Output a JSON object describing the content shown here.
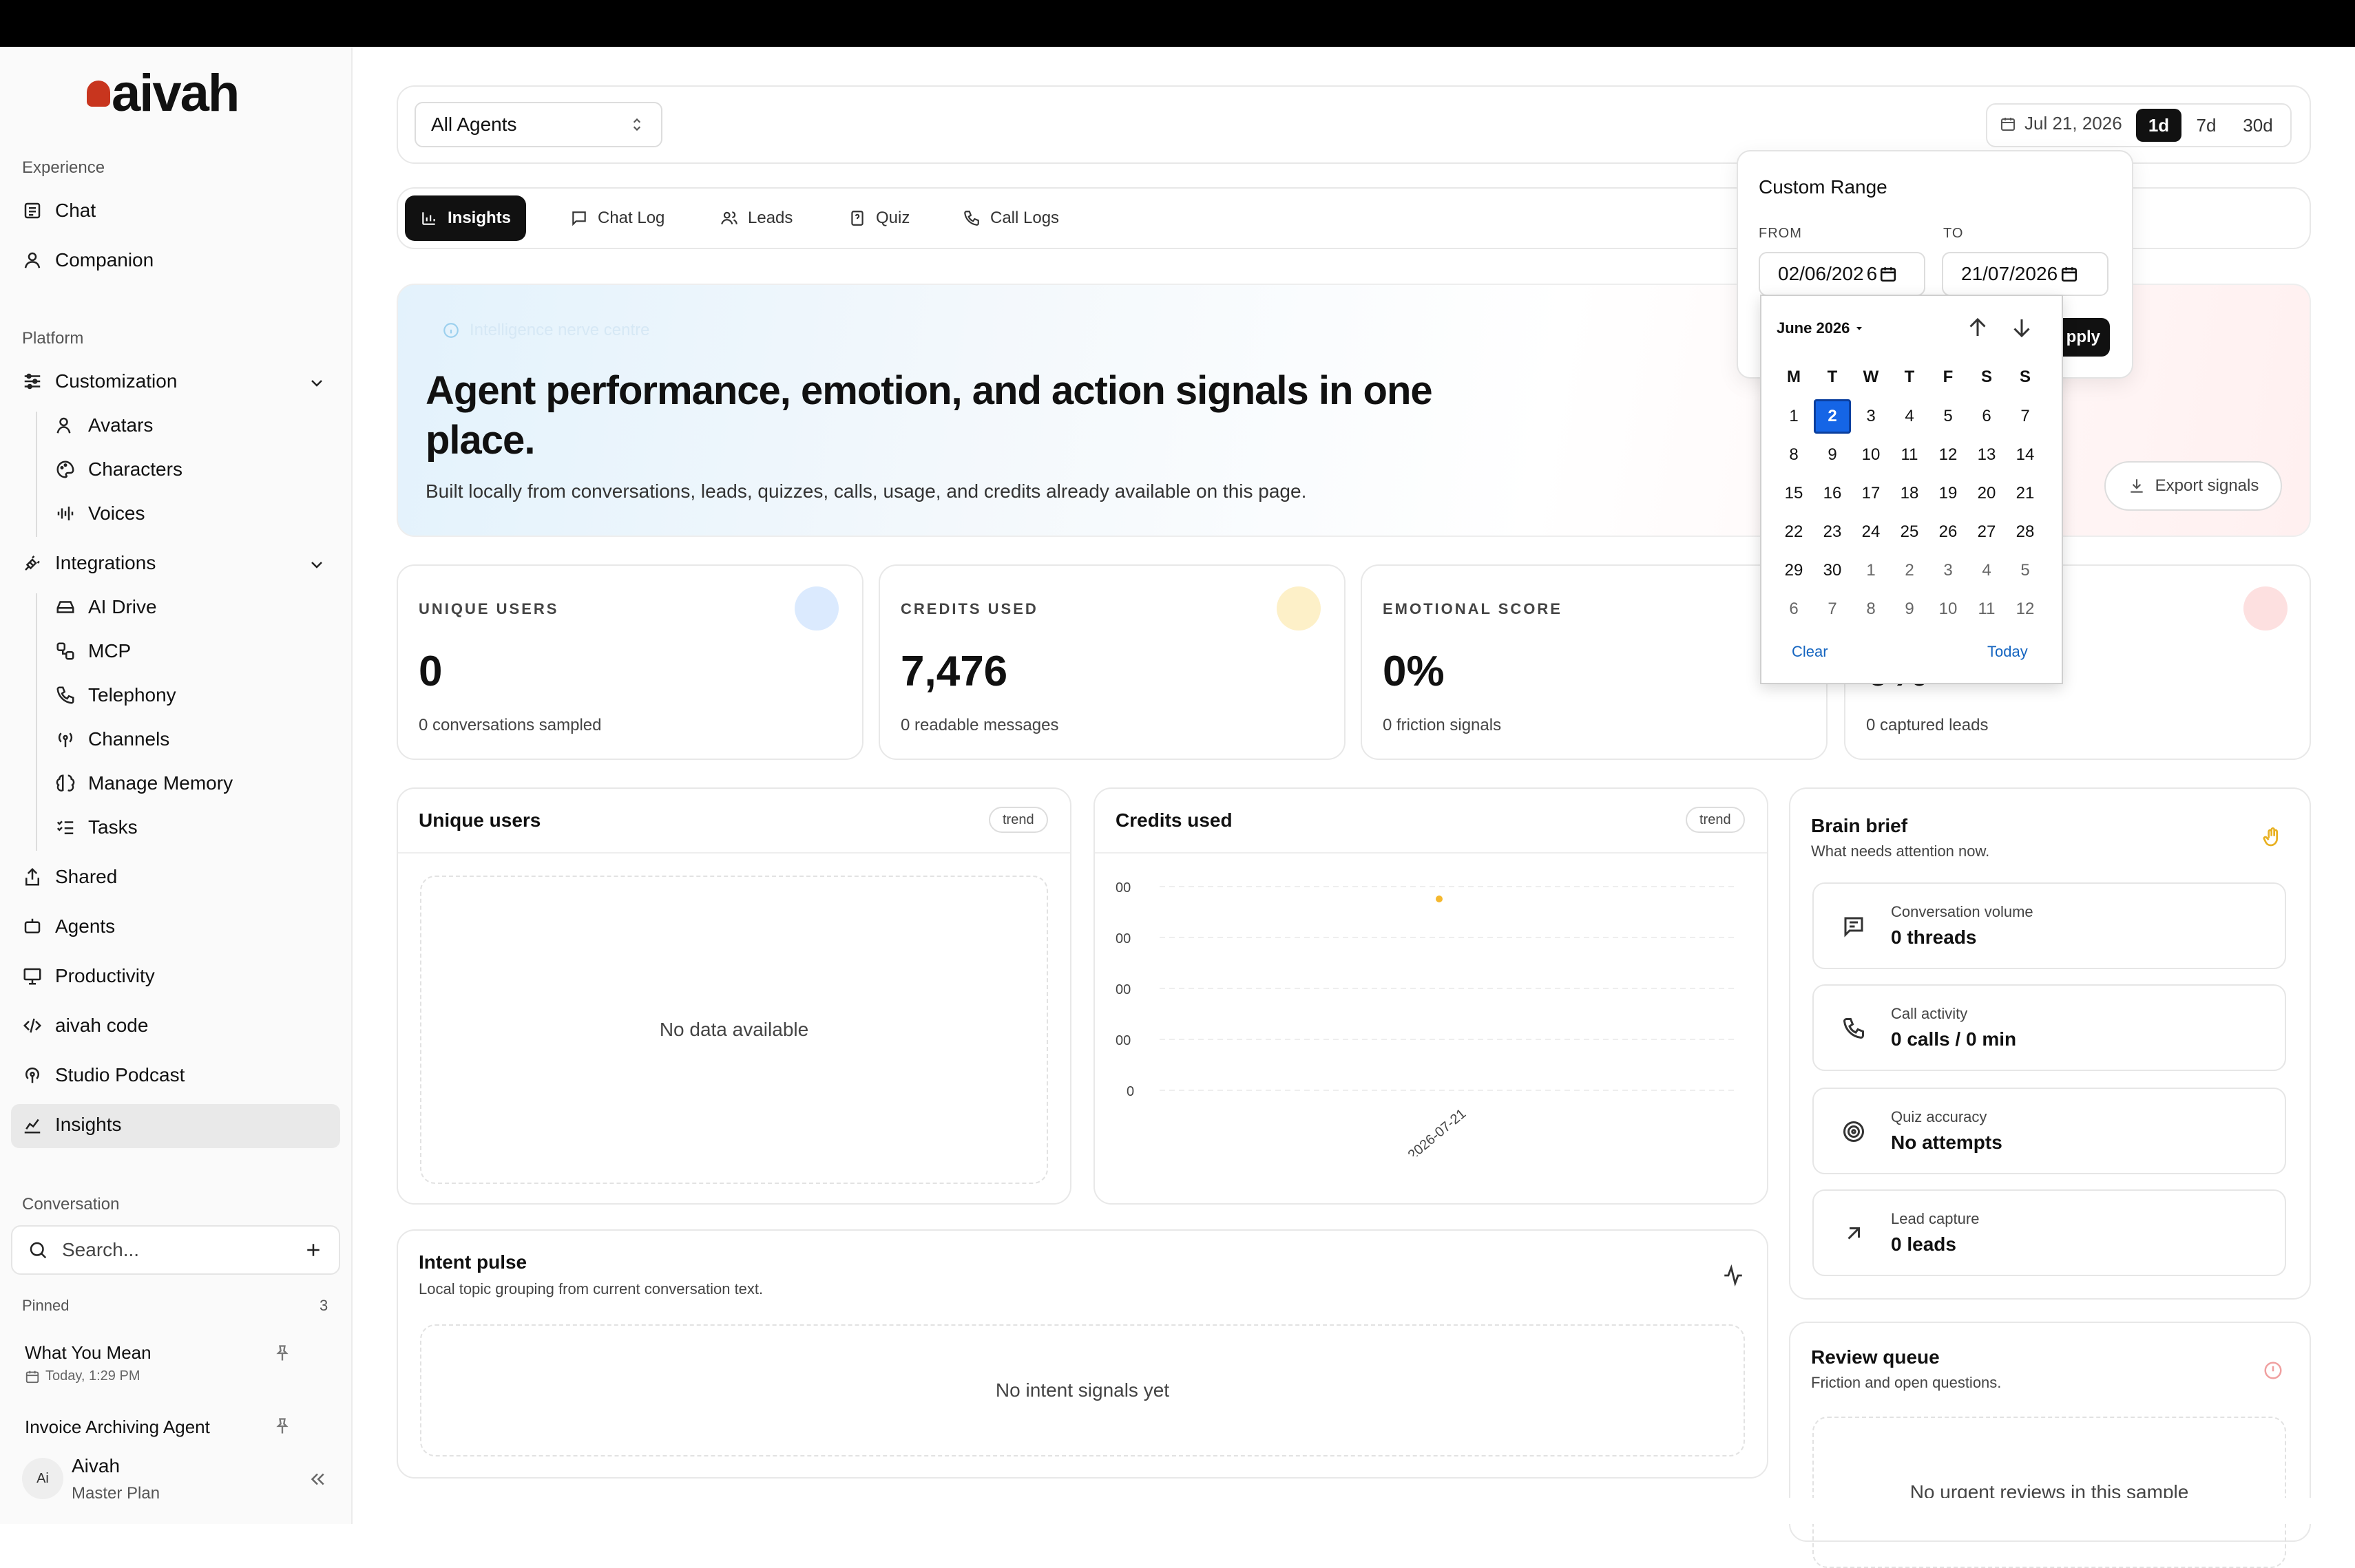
{
  "brand": {
    "name": "aivah",
    "accent": "#c8351e"
  },
  "sidebar": {
    "section_experience": "Experience",
    "chat": "Chat",
    "companion": "Companion",
    "section_platform": "Platform",
    "customization": "Customization",
    "avatars": "Avatars",
    "characters": "Characters",
    "voices": "Voices",
    "integrations": "Integrations",
    "ai_drive": "AI Drive",
    "mcp": "MCP",
    "telephony": "Telephony",
    "channels": "Channels",
    "manage_memory": "Manage Memory",
    "tasks": "Tasks",
    "shared": "Shared",
    "agents": "Agents",
    "productivity": "Productivity",
    "aivah_code": "aivah code",
    "studio_podcast": "Studio Podcast",
    "insights": "Insights",
    "section_conversation": "Conversation",
    "search_placeholder": "Search...",
    "pinned_label": "Pinned",
    "pinned_count": "3",
    "pinned": [
      {
        "title": "What You Mean",
        "time": "Today, 1:29 PM"
      },
      {
        "title": "Invoice Archiving Agent"
      }
    ],
    "user": {
      "initials": "Ai",
      "name": "Aivah",
      "plan": "Master Plan"
    }
  },
  "toolbar": {
    "agent_select": "All Agents",
    "date": "Jul 21, 2026",
    "ranges": [
      "1d",
      "7d",
      "30d"
    ]
  },
  "tabs": [
    "Insights",
    "Chat Log",
    "Leads",
    "Quiz",
    "Call Logs"
  ],
  "hero": {
    "eyebrow": "Intelligence nerve centre",
    "title_line1": "Agent performance, emotion, and action signals in one",
    "title_line2": "place.",
    "subtitle": "Built locally from conversations, leads, quizzes, calls, usage, and credits already available on this page.",
    "export": "Export signals"
  },
  "metrics": [
    {
      "label": "UNIQUE USERS",
      "value": "0",
      "sub": "0 conversations sampled",
      "color": "#dbeafe"
    },
    {
      "label": "CREDITS USED",
      "value": "7,476",
      "sub": "0 readable messages",
      "color": "#fdf0c8"
    },
    {
      "label": "EMOTIONAL SCORE",
      "value": "0%",
      "sub": "0 friction signals",
      "color": "#f3f3f3"
    },
    {
      "value": "0%",
      "sub": "0 captured leads",
      "color": "#fde0e0"
    }
  ],
  "unique_panel": {
    "title": "Unique users",
    "badge": "trend",
    "empty": "No data available"
  },
  "credits_panel": {
    "title": "Credits used",
    "badge": "trend"
  },
  "chart_data": {
    "type": "scatter",
    "x": [
      "2026-07-21"
    ],
    "y_tick_labels": [
      "00",
      "00",
      "00",
      "00",
      "0"
    ],
    "point_color": "#f5b82e",
    "grid": true
  },
  "intent": {
    "title": "Intent pulse",
    "subtitle": "Local topic grouping from current conversation text.",
    "empty": "No intent signals yet"
  },
  "brief": {
    "title": "Brain brief",
    "subtitle": "What needs attention now.",
    "items": [
      {
        "label": "Conversation volume",
        "value": "0 threads"
      },
      {
        "label": "Call activity",
        "value": "0 calls / 0 min"
      },
      {
        "label": "Quiz accuracy",
        "value": "No attempts"
      },
      {
        "label": "Lead capture",
        "value": "0 leads"
      }
    ]
  },
  "review": {
    "title": "Review queue",
    "subtitle": "Friction and open questions.",
    "empty": "No urgent reviews in this sample"
  },
  "custom_range": {
    "title": "Custom Range",
    "from_label": "FROM",
    "to_label": "TO",
    "from_value": "02/06/202",
    "to_value": "21/07/2026",
    "apply": "pply"
  },
  "calendar": {
    "month": "June 2026",
    "weekdays": [
      "M",
      "T",
      "W",
      "T",
      "F",
      "S",
      "S"
    ],
    "weeks": [
      [
        "1",
        "2",
        "3",
        "4",
        "5",
        "6",
        "7"
      ],
      [
        "8",
        "9",
        "10",
        "11",
        "12",
        "13",
        "14"
      ],
      [
        "15",
        "16",
        "17",
        "18",
        "19",
        "20",
        "21"
      ],
      [
        "22",
        "23",
        "24",
        "25",
        "26",
        "27",
        "28"
      ],
      [
        "29",
        "30",
        "1",
        "2",
        "3",
        "4",
        "5"
      ],
      [
        "6",
        "7",
        "8",
        "9",
        "10",
        "11",
        "12"
      ]
    ],
    "selected": "2",
    "clear": "Clear",
    "today": "Today"
  }
}
